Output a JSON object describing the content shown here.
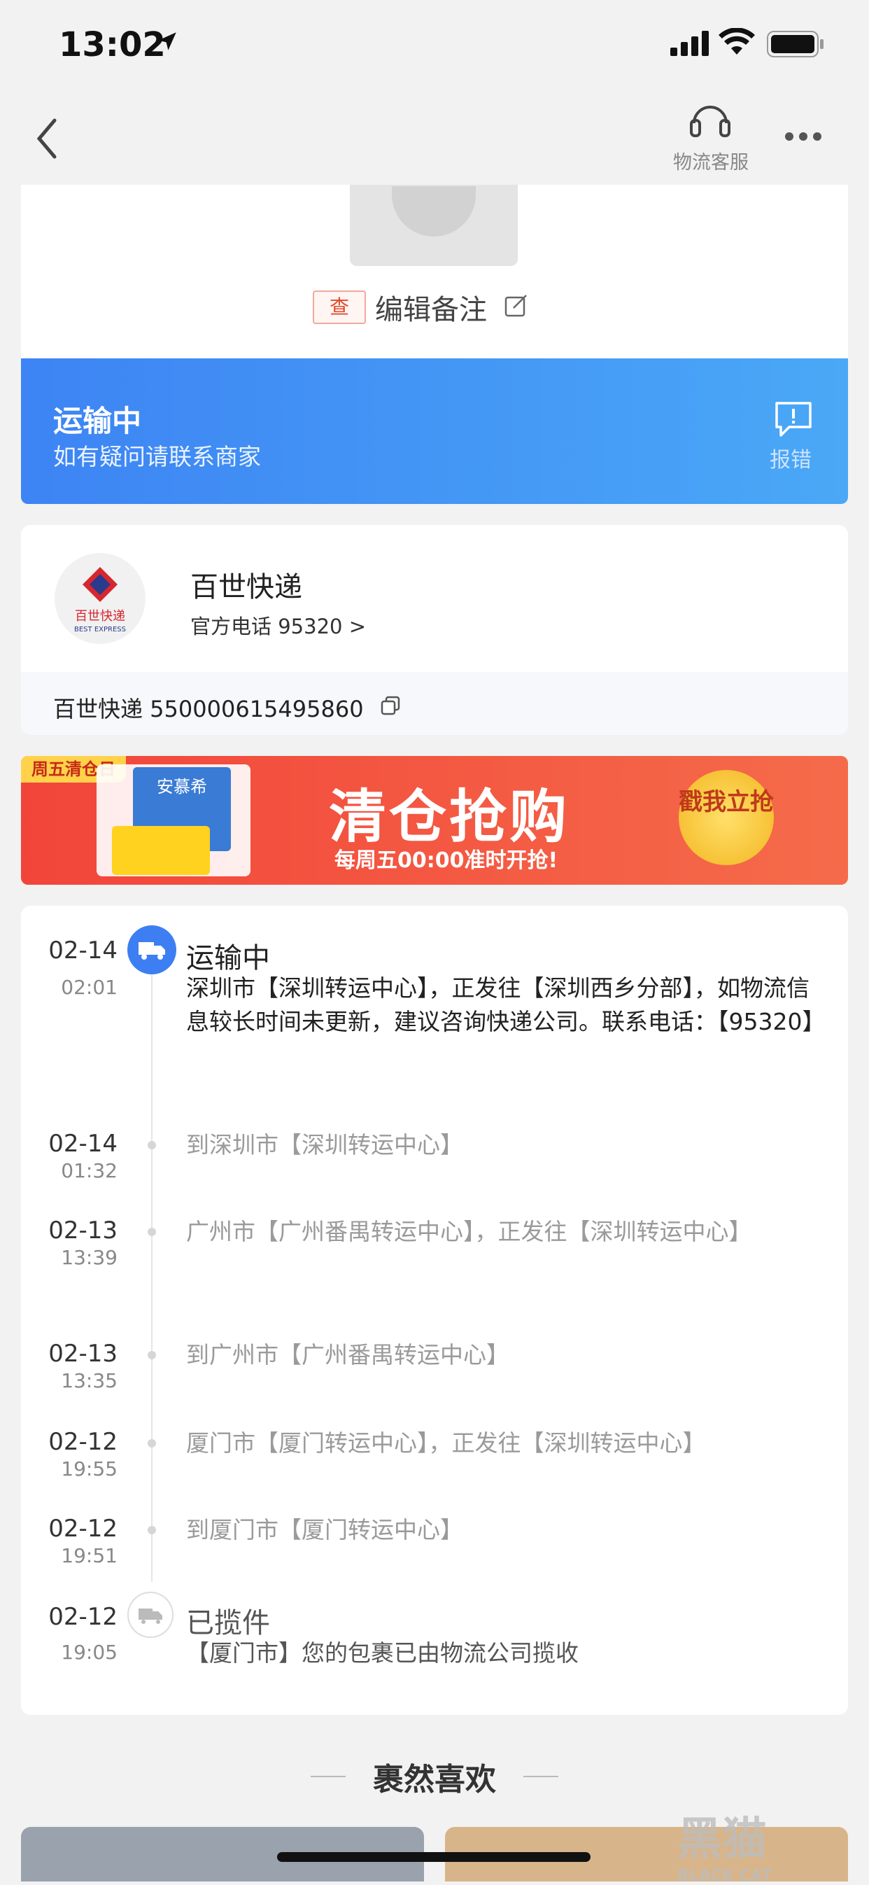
{
  "status_bar": {
    "time": "13:02"
  },
  "nav": {
    "customer_service_label": "物流客服"
  },
  "order": {
    "tag": "查",
    "edit_note": "编辑备注"
  },
  "shipping_banner": {
    "status": "运输中",
    "hint": "如有疑问请联系商家",
    "report_label": "报错"
  },
  "courier": {
    "name": "百世快递",
    "phone": "官方电话 95320 >",
    "logo_cn": "百世快递",
    "logo_en": "BEST EXPRESS",
    "tracking": "百世快递 550000615495860"
  },
  "ad": {
    "tag": "周五清仓日",
    "title": "清仓抢购",
    "subtitle": "每周五00:00准时开抢!",
    "button": "戳我立抢",
    "brand": "安慕希"
  },
  "timeline": [
    {
      "date": "02-14",
      "time": "02:01",
      "title": "运输中",
      "text": "深圳市【深圳转运中心】，正发往【深圳西乡分部】，如物流信息较长时间未更新，建议咨询快递公司。联系电话：【95320】"
    },
    {
      "date": "02-14",
      "time": "01:32",
      "text": "到深圳市【深圳转运中心】"
    },
    {
      "date": "02-13",
      "time": "13:39",
      "text": "广州市【广州番禺转运中心】，正发往【深圳转运中心】"
    },
    {
      "date": "02-13",
      "time": "13:35",
      "text": "到广州市【广州番禺转运中心】"
    },
    {
      "date": "02-12",
      "time": "19:55",
      "text": "厦门市【厦门转运中心】，正发往【深圳转运中心】"
    },
    {
      "date": "02-12",
      "time": "19:51",
      "text": "到厦门市【厦门转运中心】"
    },
    {
      "date": "02-12",
      "time": "19:05",
      "title": "已揽件",
      "text": "【厦门市】您的包裹已由物流公司揽收"
    }
  ],
  "recommend": {
    "title": "裹然喜欢"
  },
  "watermark": {
    "text": "黑猫",
    "sub": "BLACK CAT"
  },
  "colors": {
    "accent": "#3d84f4",
    "ad_red": "#f2453a"
  }
}
